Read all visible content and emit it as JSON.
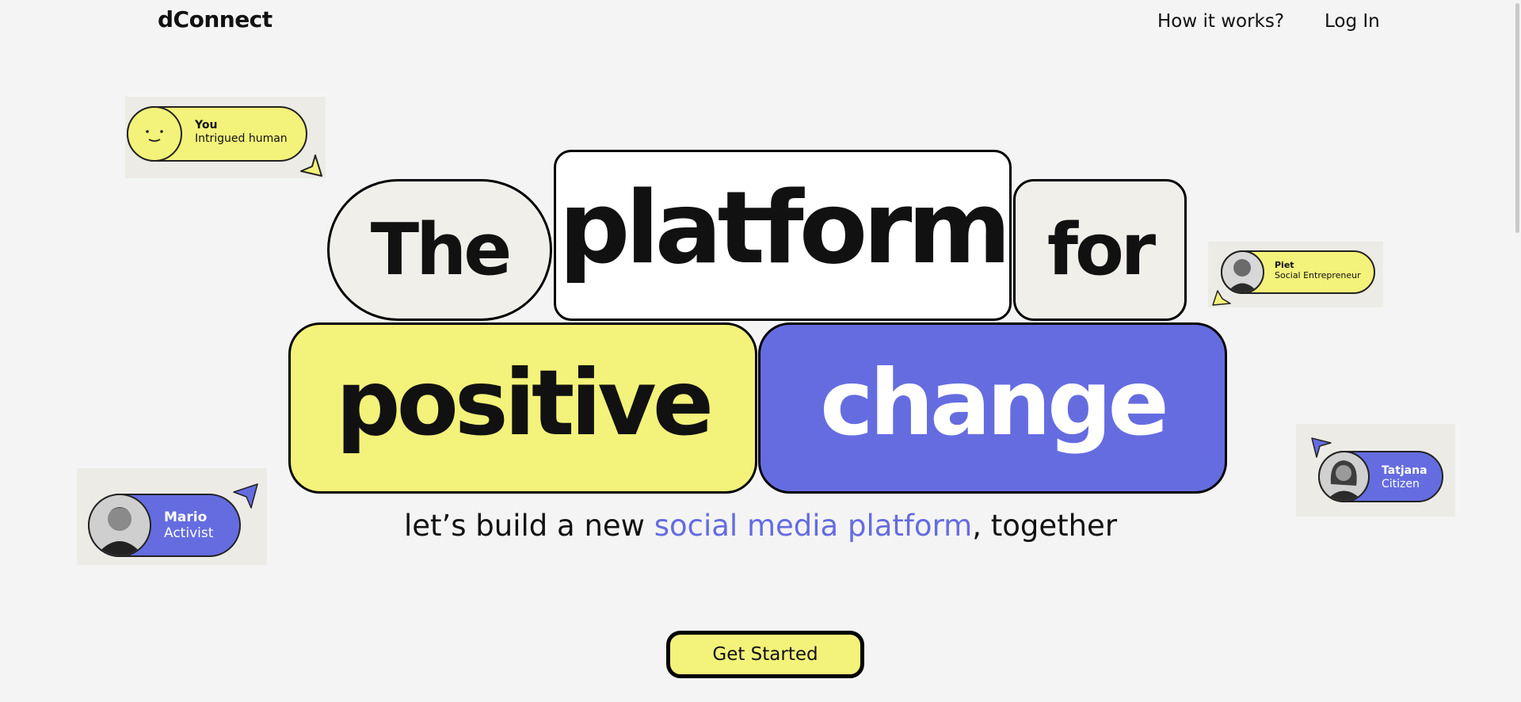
{
  "header": {
    "brand": "dConnect",
    "nav": {
      "how_it_works": "How it works?",
      "login": "Log In"
    }
  },
  "hero": {
    "words": {
      "the": "The",
      "platform": "platform",
      "for": "for",
      "positive": "positive",
      "change": "change"
    },
    "tagline": {
      "before": "let’s build a new ",
      "highlight": "social media platform",
      "after": ", together"
    },
    "cta": "Get Started"
  },
  "personas": [
    {
      "name": "You",
      "role": "Intrigued human"
    },
    {
      "name": "Piet",
      "role": "Social Entrepreneur"
    },
    {
      "name": "Tatjana",
      "role": "Citizen"
    },
    {
      "name": "Mario",
      "role": "Activist"
    }
  ],
  "colors": {
    "yellow": "#f3f27a",
    "blue": "#656ce0",
    "background": "#f4f4f4",
    "pill_neutral": "#f0efea"
  },
  "icons": {
    "you_avatar": "smiley-face-icon",
    "cursor": "cursor-arrow-icon"
  }
}
